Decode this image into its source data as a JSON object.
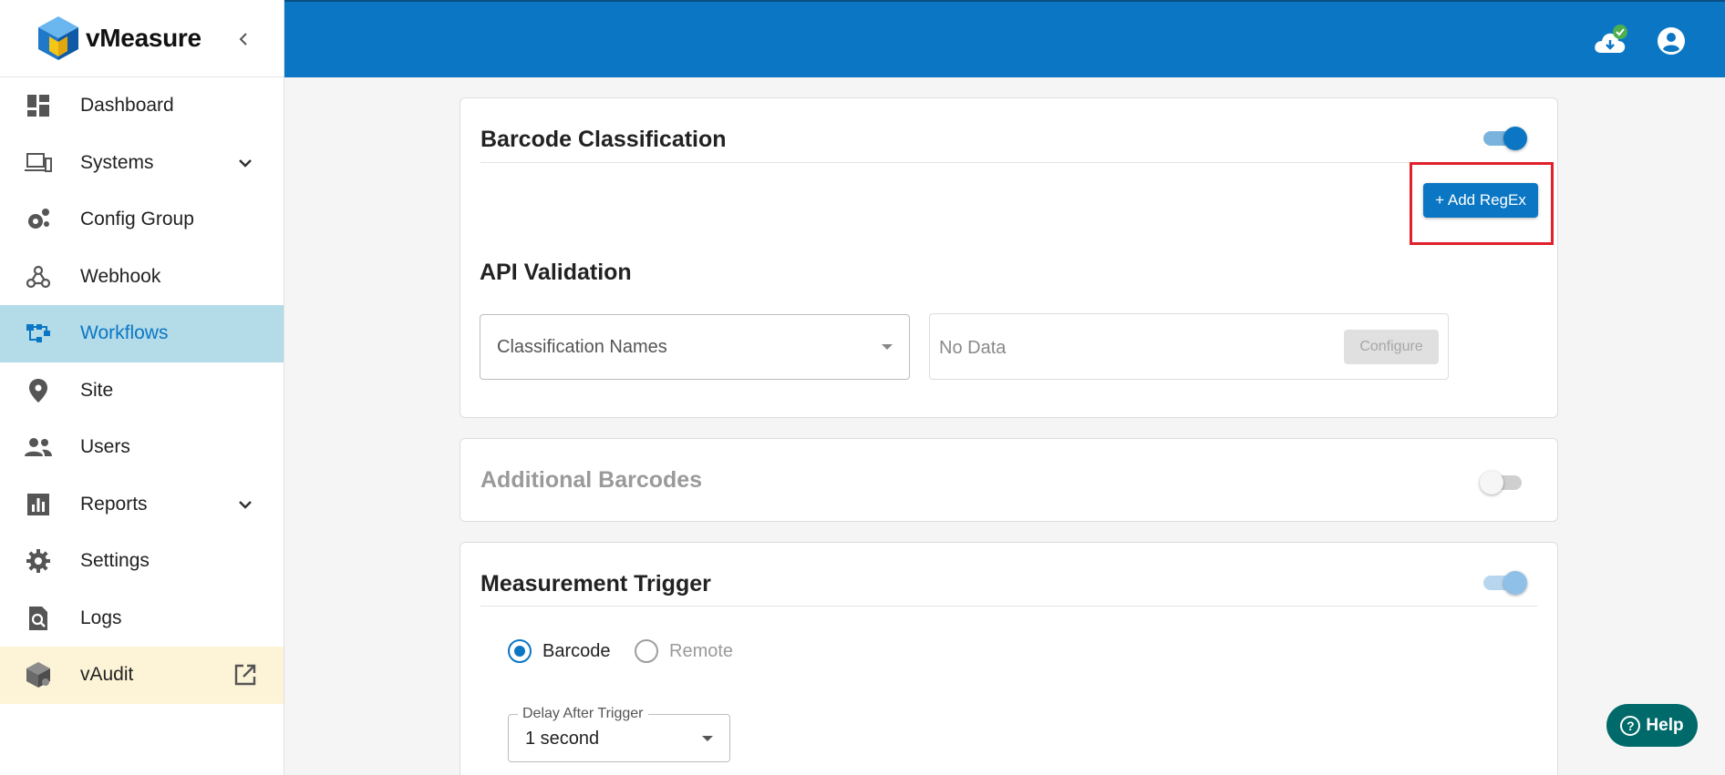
{
  "app": {
    "name": "vMeasure"
  },
  "sidebar": {
    "items": [
      {
        "label": "Dashboard",
        "icon": "dashboard-icon"
      },
      {
        "label": "Systems",
        "icon": "devices-icon",
        "expandable": true
      },
      {
        "label": "Config Group",
        "icon": "config-gears-icon"
      },
      {
        "label": "Webhook",
        "icon": "webhook-icon"
      },
      {
        "label": "Workflows",
        "icon": "workflow-icon",
        "active": true
      },
      {
        "label": "Site",
        "icon": "location-pin-icon"
      },
      {
        "label": "Users",
        "icon": "users-icon"
      },
      {
        "label": "Reports",
        "icon": "bar-chart-icon",
        "expandable": true
      },
      {
        "label": "Settings",
        "icon": "gear-icon"
      },
      {
        "label": "Logs",
        "icon": "file-search-icon"
      },
      {
        "label": "vAudit",
        "icon": "cube-icon",
        "external": true
      }
    ]
  },
  "barcode_classification": {
    "title": "Barcode Classification",
    "enabled": true,
    "add_regex_label": "+ Add RegEx"
  },
  "api_validation": {
    "title": "API Validation",
    "classification_placeholder": "Classification Names",
    "no_data_text": "No Data",
    "configure_label": "Configure"
  },
  "additional_barcodes": {
    "title": "Additional Barcodes",
    "enabled": false
  },
  "measurement_trigger": {
    "title": "Measurement Trigger",
    "enabled": true,
    "options": [
      {
        "label": "Barcode",
        "selected": true
      },
      {
        "label": "Remote",
        "selected": false
      }
    ],
    "delay_label": "Delay After Trigger",
    "delay_value": "1 second"
  },
  "help": {
    "label": "Help"
  },
  "colors": {
    "primary": "#0b77c4",
    "active_nav": "#b3dbe8",
    "vaudit_bg": "#fdf3d6",
    "help_bg": "#006a6a",
    "highlight": "#e0202a"
  }
}
